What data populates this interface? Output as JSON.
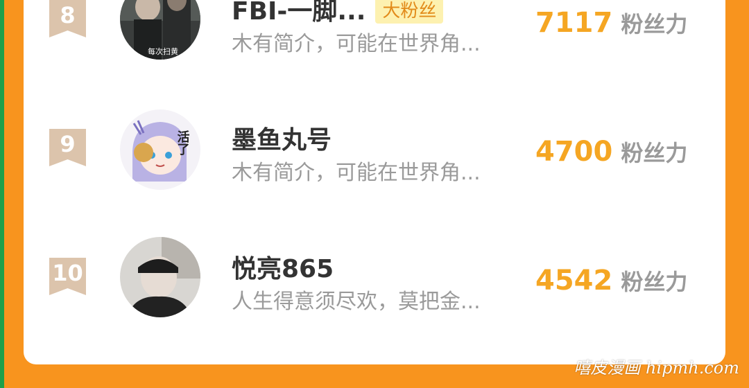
{
  "rows": [
    {
      "rank": "8",
      "name": "FBI-一脚...",
      "badge": "大粉丝",
      "bio": "木有简介，可能在世界角...",
      "power_value": "7117",
      "power_label": "粉丝力",
      "avatar_caption": "每次扫黄"
    },
    {
      "rank": "9",
      "name": "墨鱼丸号",
      "bio": "木有简介，可能在世界角...",
      "power_value": "4700",
      "power_label": "粉丝力",
      "avatar_caption": "活了"
    },
    {
      "rank": "10",
      "name": "悦亮865",
      "bio": "人生得意须尽欢，莫把金...",
      "power_value": "4542",
      "power_label": "粉丝力"
    }
  ],
  "colors": {
    "page_background": "#f8941e",
    "card_background": "#ffffff",
    "rank_badge": "#dcc4ac",
    "power_value": "#f5a623",
    "badge_background": "#fdf1b0",
    "badge_text": "#e28b1a"
  },
  "watermark": "嘻皮漫画 hipmh.com"
}
